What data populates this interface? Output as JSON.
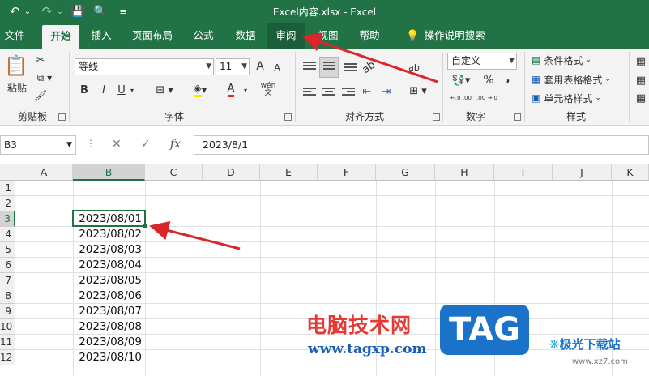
{
  "titlebar": {
    "title": "Excel内容.xlsx  -  Excel",
    "undo_glyph": "↶",
    "undo_dropdown_glyph": "⌄",
    "redo_glyph": "↷",
    "redo_dropdown_glyph": "⌄",
    "save_glyph": "💾",
    "preview_glyph": "🔍",
    "customize_glyph": "≡"
  },
  "tabs": [
    {
      "label": "文件"
    },
    {
      "label": "开始"
    },
    {
      "label": "插入"
    },
    {
      "label": "页面布局"
    },
    {
      "label": "公式"
    },
    {
      "label": "数据"
    },
    {
      "label": "审阅"
    },
    {
      "label": "视图"
    },
    {
      "label": "帮助"
    },
    {
      "label": "操作说明搜索"
    }
  ],
  "ribbon": {
    "clipboard": {
      "label": "剪贴板",
      "paste": "粘贴"
    },
    "font": {
      "label": "字体",
      "font_name": "等线",
      "font_size": "11",
      "grow": "A",
      "shrink": "A",
      "bold": "B",
      "italic": "I",
      "underline": "U",
      "font_color_glyph": "A",
      "phonetic": "wén"
    },
    "alignment": {
      "label": "对齐方式",
      "wrap": "ab",
      "merge_glyph": "⊞"
    },
    "number": {
      "label": "数字",
      "format": "自定义",
      "percent": "%",
      "comma": ",",
      "inc_decimal": "←.0 .00",
      "dec_decimal": ".00 →.0"
    },
    "styles": {
      "label": "样式",
      "conditional": "条件格式",
      "table": "套用表格格式",
      "cell": "单元格样式"
    }
  },
  "formula_bar": {
    "name_box": "B3",
    "more_glyph": "⋮",
    "cancel_glyph": "✕",
    "enter_glyph": "✓",
    "fx": "fx",
    "formula": "2023/8/1"
  },
  "sheet": {
    "columns": [
      "A",
      "B",
      "C",
      "D",
      "E",
      "F",
      "G",
      "H",
      "I",
      "J",
      "K"
    ],
    "rows": [
      "1",
      "2",
      "3",
      "4",
      "5",
      "6",
      "7",
      "8",
      "9",
      "10",
      "11",
      "12"
    ],
    "active_cell": "B3",
    "column_b_values": [
      "",
      "",
      "2023/08/01",
      "2023/08/02",
      "2023/08/03",
      "2023/08/04",
      "2023/08/05",
      "2023/08/06",
      "2023/08/07",
      "2023/08/08",
      "2023/08/09",
      "2023/08/10"
    ]
  },
  "watermark": {
    "site_name": "电脑技术网",
    "site_url": "www.tagxp.com",
    "tag": "TAG",
    "brand": "极光下载站",
    "brand_url": "www.xz7.com"
  },
  "colors": {
    "excel_green": "#217346",
    "arrow_red": "#d9262a",
    "watermark_red": "#e53935",
    "watermark_blue": "#1a73c9"
  }
}
